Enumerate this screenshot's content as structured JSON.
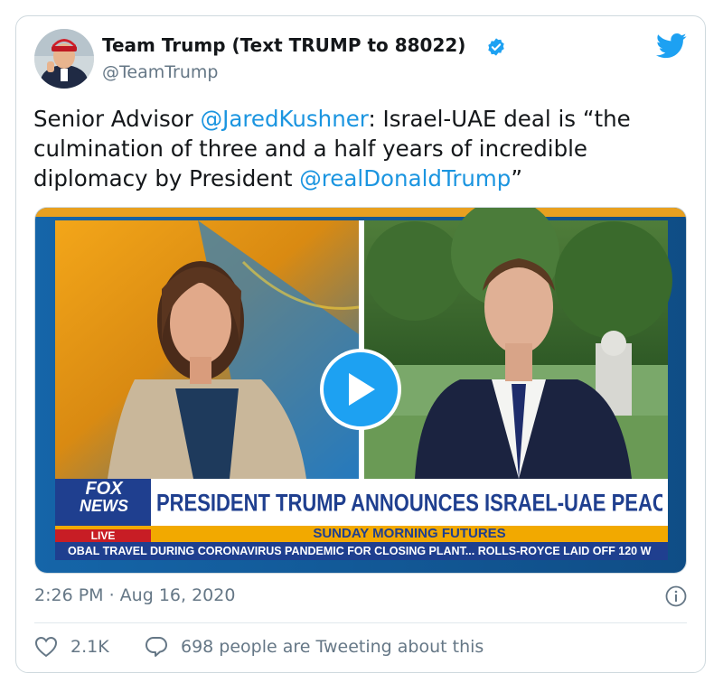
{
  "author": {
    "name": "Team Trump (Text TRUMP to 88022)",
    "handle": "@TeamTrump"
  },
  "tweet": {
    "text_prefix": "Senior Advisor ",
    "mention1": "@JaredKushner",
    "text_middle": ": Israel-UAE deal is “the culmination of three and a half years of incredible diplomacy by President ",
    "mention2": "@realDonaldTrump",
    "text_suffix": "”"
  },
  "video": {
    "logo_top": "FOX",
    "logo_bottom": "NEWS",
    "live_label": "LIVE",
    "headline": "PRESIDENT TRUMP ANNOUNCES ISRAEL-UAE PEACE DEAL",
    "show_name": "SUNDAY MORNING FUTURES",
    "ticker": "OBAL TRAVEL DURING CORONAVIRUS PANDEMIC FOR CLOSING PLANT...   ROLLS-ROYCE LAID OFF 120 W"
  },
  "footer": {
    "timestamp": "2:26 PM · Aug 16, 2020",
    "likes": "2.1K",
    "talking": "698 people are Tweeting about this"
  },
  "colors": {
    "accent": "#1da1f2",
    "link": "#1b95e0",
    "secondary_text": "#657786",
    "fox_red": "#c81d25",
    "fox_blue": "#1f3f8f",
    "ticker_yellow": "#f2a900"
  }
}
